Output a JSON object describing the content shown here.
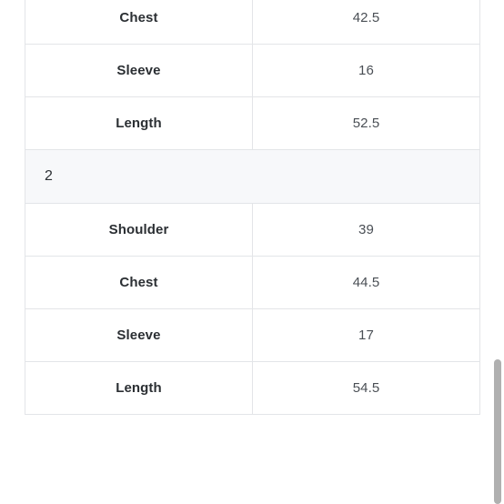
{
  "table": {
    "rows": [
      {
        "kind": "measure",
        "label": "Chest",
        "value": "42.5"
      },
      {
        "kind": "measure",
        "label": "Sleeve",
        "value": "16"
      },
      {
        "kind": "measure",
        "label": "Length",
        "value": "52.5"
      },
      {
        "kind": "group",
        "label": "2",
        "value": ""
      },
      {
        "kind": "measure",
        "label": "Shoulder",
        "value": "39"
      },
      {
        "kind": "measure",
        "label": "Chest",
        "value": "44.5"
      },
      {
        "kind": "measure",
        "label": "Sleeve",
        "value": "17"
      },
      {
        "kind": "measure",
        "label": "Length",
        "value": "54.5"
      }
    ]
  },
  "scrollbar": {
    "orientation": "vertical",
    "thumb_color": "#b0b0b0"
  },
  "colors": {
    "page_background": "#ffffff",
    "cell_background": "#ffffff",
    "group_row_background": "#f7f8fa",
    "border": "#e3e5e8",
    "label_text": "#2b2f33",
    "value_text": "#4a4f55"
  }
}
